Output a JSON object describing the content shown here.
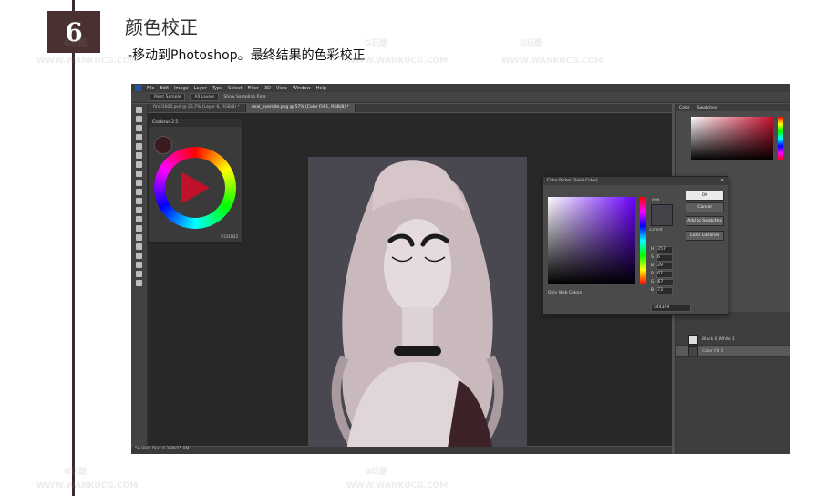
{
  "step": {
    "number": "6",
    "title": "颜色校正"
  },
  "subtitle": "-移动到Photoshop。最终结果的色彩校正",
  "photoshop": {
    "menu": [
      "File",
      "Edit",
      "Image",
      "Layer",
      "Type",
      "Select",
      "Filter",
      "3D",
      "View",
      "Window",
      "Help"
    ],
    "options": {
      "sample_size": "Point Sample",
      "sample": "All Layers",
      "show_ring": "Show Sampling Ring"
    },
    "tabs": [
      "final1000.psd @ 25,7% (Layer 6, RGB/8) *",
      "deal_override.png @ 57% (Color Fill 1, RGB/8) *"
    ],
    "status": "56.99%     Doc: 6.36M/25.8M",
    "coolorus": {
      "title": "Coolorus 2.5",
      "value": "#231D22"
    },
    "color_panel": {
      "tabs": [
        "Color",
        "Swatches"
      ]
    },
    "layers": [
      {
        "name": "Black & White 1"
      },
      {
        "name": "Color Fill 1"
      }
    ],
    "picker": {
      "title": "Color Picker (Solid Color)",
      "new_label": "new",
      "current_label": "current",
      "buttons": [
        "OK",
        "Cancel",
        "Add to Swatches",
        "Color Libraries"
      ],
      "only_web_colors": "Only Web Colors",
      "fields": [
        {
          "label": "H",
          "value": "257"
        },
        {
          "label": "S",
          "value": "6"
        },
        {
          "label": "B",
          "value": "29"
        },
        {
          "label": "R",
          "value": "67"
        },
        {
          "label": "G",
          "value": "67"
        },
        {
          "label": "B",
          "value": "73"
        }
      ],
      "hex": "444349"
    }
  },
  "watermark": {
    "logo": "G玩酷",
    "url": "WWW.WANKUCG.COM"
  }
}
